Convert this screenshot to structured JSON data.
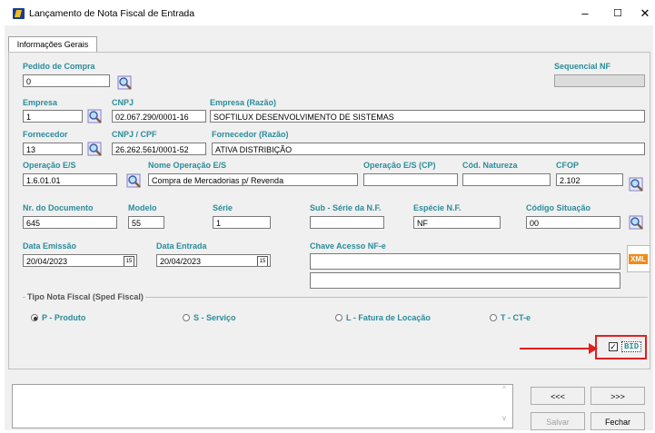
{
  "window": {
    "title": "Lançamento de Nota Fiscal de Entrada",
    "minimize": "–",
    "maximize": "☐",
    "close": "✕"
  },
  "tabs": [
    {
      "label": "Informações Gerais"
    }
  ],
  "fields": {
    "pedido_compra": {
      "label": "Pedido de Compra",
      "value": "0"
    },
    "sequencial_nf": {
      "label": "Sequencial NF",
      "value": ""
    },
    "empresa": {
      "label": "Empresa",
      "value": "1"
    },
    "cnpj": {
      "label": "CNPJ",
      "value": "02.067.290/0001-16"
    },
    "empresa_razao": {
      "label": "Empresa (Razão)",
      "value": "SOFTILUX DESENVOLVIMENTO DE SISTEMAS"
    },
    "fornecedor": {
      "label": "Fornecedor",
      "value": "13"
    },
    "cnpj_cpf": {
      "label": "CNPJ / CPF",
      "value": "26.262.561/0001-52"
    },
    "fornecedor_razao": {
      "label": "Fornecedor (Razão)",
      "value": "ATIVA DISTRIBIÇÃO"
    },
    "operacao_es": {
      "label": "Operação E/S",
      "value": "1.6.01.01"
    },
    "nome_operacao": {
      "label": "Nome Operação E/S",
      "value": "Compra de Mercadorias p/ Revenda"
    },
    "operacao_es_cp": {
      "label": "Operação E/S (CP)",
      "value": ""
    },
    "cod_natureza": {
      "label": "Cód. Natureza",
      "value": ""
    },
    "cfop": {
      "label": "CFOP",
      "value": "2.102"
    },
    "nr_documento": {
      "label": "Nr. do Documento",
      "value": "645"
    },
    "modelo": {
      "label": "Modelo",
      "value": "55"
    },
    "serie": {
      "label": "Série",
      "value": "1"
    },
    "sub_serie": {
      "label": "Sub - Série da N.F.",
      "value": ""
    },
    "especie": {
      "label": "Espécie N.F.",
      "value": "NF"
    },
    "codigo_situacao": {
      "label": "Código Situação",
      "value": "00"
    },
    "data_emissao": {
      "label": "Data Emissão",
      "value": "20/04/2023"
    },
    "data_entrada": {
      "label": "Data Entrada",
      "value": "20/04/2023"
    },
    "chave_acesso": {
      "label": "Chave Acesso NF-e",
      "value": "",
      "value2": ""
    }
  },
  "tipo_nota": {
    "title": "Tipo Nota Fiscal (Sped Fiscal)",
    "options": [
      {
        "label": "P - Produto",
        "selected": true
      },
      {
        "label": "S - Serviço",
        "selected": false
      },
      {
        "label": "L - Fatura de Locação",
        "selected": false
      },
      {
        "label": "T - CT-e",
        "selected": false
      }
    ]
  },
  "bid": {
    "label": "BID",
    "checked": true,
    "check_mark": "✓"
  },
  "xml_label": "XML",
  "calendar_glyph": "15",
  "buttons": {
    "prev": "<<<",
    "next": ">>>",
    "save": "Salvar",
    "close": "Fechar"
  },
  "memo": {
    "value": "",
    "scroll_up": "^",
    "scroll_down": "v"
  },
  "colors": {
    "label": "#2b8c9a",
    "highlight": "#e02020"
  }
}
